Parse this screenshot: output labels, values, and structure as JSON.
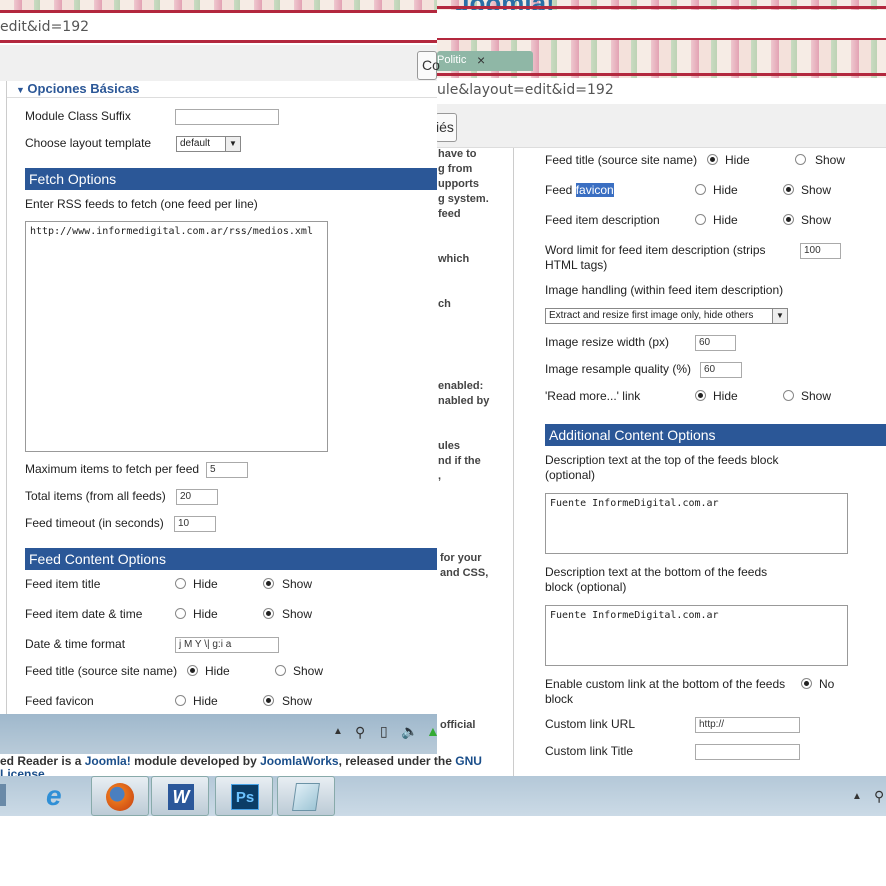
{
  "right_window": {
    "tab_label": "Politic",
    "tab_close": "×",
    "url": "ule&layout=edit&id=192",
    "header_button": "iés",
    "logo_text": "Joomla!",
    "feed_title_label": "Feed title (source site name)",
    "feed_favicon_label_pre": "Feed ",
    "feed_favicon_label_sel": "favicon",
    "feed_item_description_label": "Feed item description",
    "word_limit_label_1": "Word limit for feed item description (strips",
    "word_limit_label_2": "HTML tags)",
    "word_limit_value": "100",
    "image_handling_label": "Image handling (within feed item description)",
    "image_handling_value": "Extract and resize first image only, hide others",
    "image_resize_label": "Image resize width (px)",
    "image_resize_value": "60",
    "image_quality_label": "Image resample quality (%)",
    "image_quality_value": "60",
    "read_more_label": "'Read more...' link",
    "hide": "Hide",
    "show": "Show",
    "no": "No",
    "additional_section": "Additional Content Options",
    "desc_top_label_1": "Description text at the top of the feeds block",
    "desc_top_label_2": "(optional)",
    "desc_top_value": "Fuente InformeDigital.com.ar",
    "desc_bottom_label_1": "Description text at the bottom of the feeds",
    "desc_bottom_label_2": "block (optional)",
    "desc_bottom_value": "Fuente InformeDigital.com.ar",
    "custom_link_label_1": "Enable custom link at the bottom of the feeds",
    "custom_link_label_2": "block",
    "custom_url_label": "Custom link URL",
    "custom_url_value": "http://",
    "custom_title_label": "Custom link Title",
    "custom_title_value": ""
  },
  "middle_fragments": [
    "have to",
    "g from",
    "upports",
    "g system.",
    "feed",
    "which",
    "ch",
    "enabled:",
    "nabled by",
    "ules",
    "nd if the",
    ",",
    "for your",
    "and CSS,",
    "official"
  ],
  "left_window": {
    "url": "edit&id=192",
    "button_partial": "Co",
    "basic_section": "Opciones Básicas",
    "module_suffix_label": "Module Class Suffix",
    "module_suffix_value": "",
    "layout_label": "Choose layout template",
    "layout_value": "default",
    "fetch_section": "Fetch Options",
    "rss_label": "Enter RSS feeds to fetch (one feed per line)",
    "rss_value": "http://www.informedigital.com.ar/rss/medios.xml",
    "max_items_label": "Maximum items to fetch per feed",
    "max_items_value": "5",
    "total_items_label": "Total items (from all feeds)",
    "total_items_value": "20",
    "timeout_label": "Feed timeout (in seconds)",
    "timeout_value": "10",
    "content_section": "Feed Content Options",
    "item_title_label": "Feed item title",
    "item_date_label": "Feed item date & time",
    "date_format_label": "Date & time format",
    "date_format_value": "j M Y \\| g:i a",
    "feed_title_label": "Feed title (source site name)",
    "feed_favicon_label": "Feed favicon",
    "hide": "Hide",
    "show": "Show"
  },
  "footer": {
    "pre": "ed Reader is a ",
    "joomla": "Joomla!",
    "mid": " module developed by ",
    "jw": "JoomlaWorks",
    "post": ", released under the ",
    "gnu": "GNU",
    "line2": " License"
  },
  "taskbar": {
    "icons": [
      "ie-icon",
      "firefox-icon",
      "word-icon",
      "photoshop-icon",
      "notepad-icon"
    ],
    "ps_label": "Ps",
    "word_label": "W"
  }
}
